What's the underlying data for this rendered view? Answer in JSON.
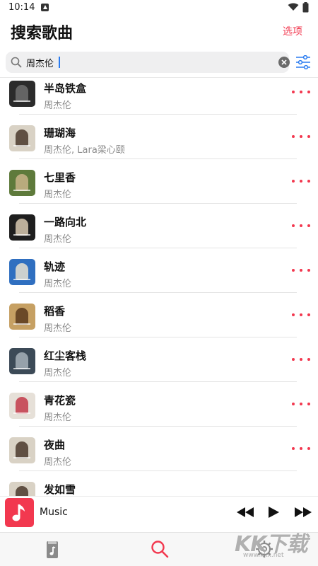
{
  "status_bar": {
    "time": "10:14"
  },
  "header": {
    "title": "搜索歌曲",
    "options_label": "选项"
  },
  "search": {
    "value": "周杰伦",
    "placeholder": ""
  },
  "songs": [
    {
      "title": "半岛铁盒",
      "artist": "周杰伦"
    },
    {
      "title": "珊瑚海",
      "artist": "周杰伦, Lara梁心颐"
    },
    {
      "title": "七里香",
      "artist": "周杰伦"
    },
    {
      "title": "一路向北",
      "artist": "周杰伦"
    },
    {
      "title": "轨迹",
      "artist": "周杰伦"
    },
    {
      "title": "稻香",
      "artist": "周杰伦"
    },
    {
      "title": "红尘客栈",
      "artist": "周杰伦"
    },
    {
      "title": "青花瓷",
      "artist": "周杰伦"
    },
    {
      "title": "夜曲",
      "artist": "周杰伦"
    },
    {
      "title": "发如雪",
      "artist": ""
    }
  ],
  "album_art_colors": [
    [
      "#2b2b2b",
      "#6e6e6e"
    ],
    [
      "#d9d2c5",
      "#4a3a2c"
    ],
    [
      "#5e7a3b",
      "#c9b48a"
    ],
    [
      "#1e1e1e",
      "#d8c9b0"
    ],
    [
      "#2f6fc0",
      "#e8e2d0"
    ],
    [
      "#c6a063",
      "#5a3a1c"
    ],
    [
      "#3c4a57",
      "#a6b0b8"
    ],
    [
      "#e6e0d8",
      "#c23a4a"
    ],
    [
      "#d9d2c5",
      "#4a3a2c"
    ],
    [
      "#d9d2c5",
      "#4a3a2c"
    ]
  ],
  "mini_player": {
    "title": "Music"
  },
  "tabs": [
    {
      "name": "library-tab",
      "icon": "music-note-icon"
    },
    {
      "name": "search-tab",
      "icon": "search-icon",
      "active": true
    },
    {
      "name": "settings-tab",
      "icon": "gear-icon"
    }
  ],
  "colors": {
    "accent": "#f2384f",
    "link_blue": "#2a7cf0",
    "secondary_text": "#8a8a8a"
  },
  "watermark": {
    "text": "KK下载",
    "url": "www.kkx.net"
  }
}
